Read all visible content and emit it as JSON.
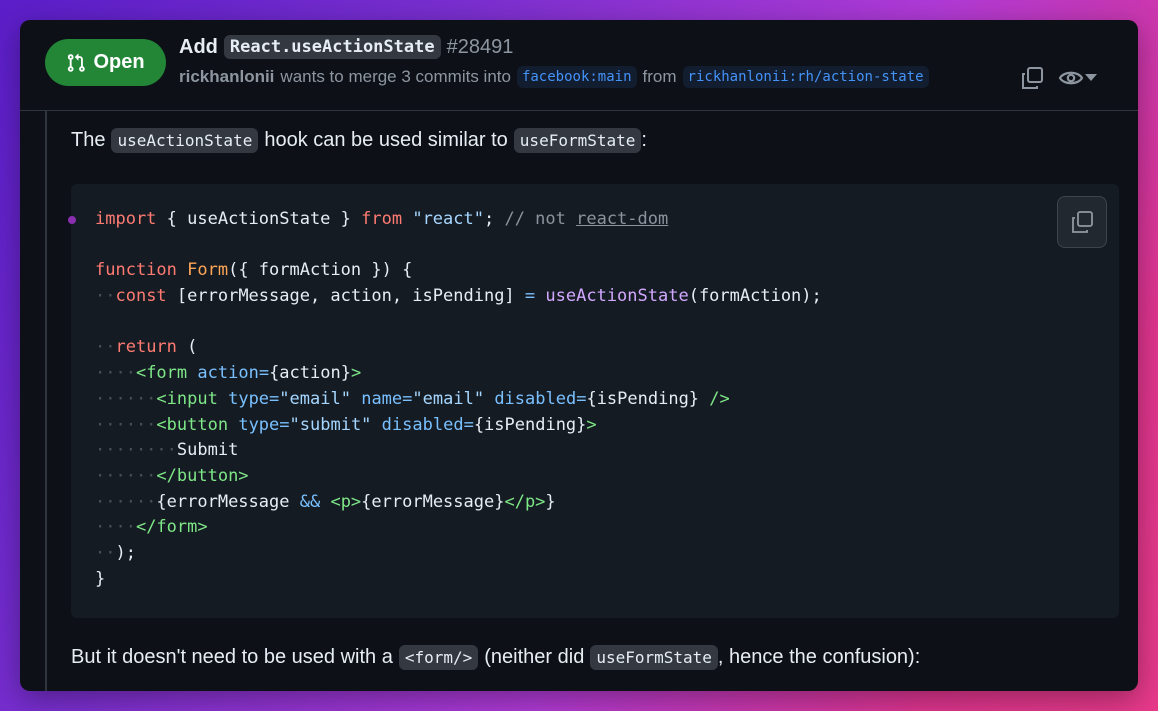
{
  "header": {
    "status": "Open",
    "title_prefix": "Add",
    "title_code": "React.useActionState",
    "pr_number": "#28491",
    "author": "rickhanlonii",
    "merge_text": "wants to merge 3 commits into",
    "base_branch": "facebook:main",
    "from_text": "from",
    "head_branch": "rickhanlonii:rh/action-state"
  },
  "icons": [
    "git-pull-request-icon",
    "copy-icon",
    "eye-icon",
    "caret-down-icon"
  ],
  "colors": {
    "open_badge": "#238636",
    "background": "#0d1117"
  },
  "body": {
    "p1": {
      "pre": "The",
      "code1": "useActionState",
      "mid": "hook can be used similar to",
      "code2": "useFormState",
      "post": ":"
    },
    "p2": {
      "pre": "But it doesn't need to be used with a",
      "code1": "<form/>",
      "mid": "(neither did",
      "code2": "useFormState",
      "post": ", hence the confusion):"
    }
  },
  "code": {
    "l1": {
      "kw1": "import",
      "t1": " { useActionState } ",
      "kw2": "from",
      "sp": " ",
      "str": "\"react\"",
      "semi": "; ",
      "cm": "// not ",
      "link": "react-dom"
    },
    "l3": {
      "kw": "function",
      "sp": " ",
      "fn": "Form",
      "rest": "({ formAction }) {"
    },
    "l4": {
      "ws": "··",
      "kw": "const",
      "t1": " [errorMessage, action, isPending] ",
      "op": "=",
      "sp": " ",
      "fn": "useActionState",
      "rest": "(formAction);"
    },
    "l6": {
      "ws": "··",
      "kw": "return",
      "rest": " ("
    },
    "l7": {
      "ws": "····",
      "tag": "<form",
      "sp": " ",
      "attr": "action",
      "op": "=",
      "rest": "{action}",
      "close": ">"
    },
    "l8": {
      "ws": "······",
      "tag": "<input",
      "sp1": " ",
      "attr1": "type",
      "op1": "=",
      "str1": "\"email\"",
      "sp2": " ",
      "attr2": "name",
      "op2": "=",
      "str2": "\"email\"",
      "sp3": " ",
      "attr3": "disabled",
      "op3": "=",
      "rest": "{isPending}",
      "close": " />"
    },
    "l9": {
      "ws": "······",
      "tag": "<button",
      "sp1": " ",
      "attr1": "type",
      "op1": "=",
      "str1": "\"submit\"",
      "sp2": " ",
      "attr2": "disabled",
      "op2": "=",
      "rest": "{isPending}",
      "close": ">"
    },
    "l10": {
      "ws": "········",
      "text": "Submit"
    },
    "l11": {
      "ws": "······",
      "tag": "</button>"
    },
    "l12": {
      "ws": "······",
      "t1": "{errorMessage ",
      "op": "&&",
      "sp": " ",
      "tag1": "<p>",
      "t2": "{errorMessage}",
      "tag2": "</p>",
      "t3": "}"
    },
    "l13": {
      "ws": "····",
      "tag": "</form>"
    },
    "l14": {
      "ws": "··",
      "text": ");"
    },
    "l15": {
      "text": "}"
    }
  }
}
